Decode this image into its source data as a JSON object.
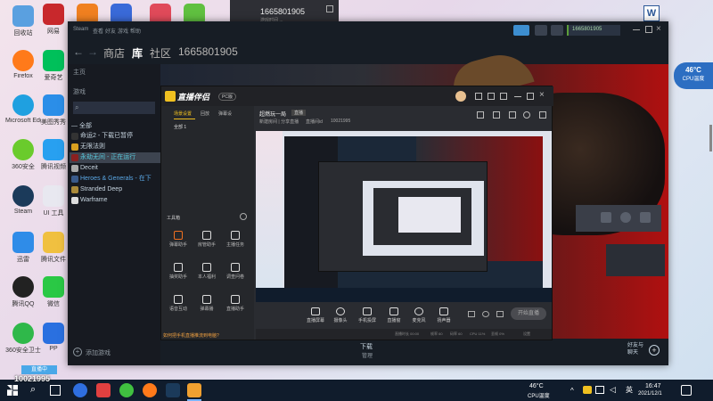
{
  "desktop": {
    "icons": [
      {
        "label": "回收站",
        "color": "#5aa0e0"
      },
      {
        "label": "网易",
        "color": "#c8282c"
      },
      {
        "label": "",
        "color": "#f08020"
      },
      {
        "label": "",
        "color": "#3a6ad8"
      },
      {
        "label": "",
        "color": "#e04a5a"
      },
      {
        "label": "",
        "color": "#60c040"
      },
      {
        "label": "Firefox",
        "color": "#ff7a1a"
      },
      {
        "label": "爱奇艺",
        "color": "#00c05a"
      },
      {
        "label": "Microsoft Edge",
        "color": "#1fa0e0"
      },
      {
        "label": "美图秀秀",
        "color": "#2b8ee8"
      },
      {
        "label": "360安全",
        "color": "#6acb2c"
      },
      {
        "label": "腾讯视频",
        "color": "#28a0f0"
      },
      {
        "label": "Steam",
        "color": "#1b3a5a"
      },
      {
        "label": "UI 工具",
        "color": "#e8e8f0"
      },
      {
        "label": "迅雷",
        "color": "#2f8ce8"
      },
      {
        "label": "腾讯文件",
        "color": "#f0c040"
      },
      {
        "label": "腾讯QQ",
        "color": "#222222"
      },
      {
        "label": "微信",
        "color": "#2ac845"
      },
      {
        "label": "360安全卫士",
        "color": "#2fb84a"
      },
      {
        "label": "PP",
        "color": "#2a70e0"
      }
    ],
    "top_right_icon": "W"
  },
  "overlay_window": {
    "title": "1665801905",
    "subtitle": "游戏时间 ..."
  },
  "steam": {
    "title": "Steam",
    "menu": [
      "Steam",
      "查看",
      "好友",
      "游戏",
      "帮助"
    ],
    "nav": [
      "商店",
      "库",
      "社区"
    ],
    "username": "1665801905",
    "account_badge": "1665801905",
    "lib_home": "主页",
    "games_label": "游戏",
    "all_label": "— 全部",
    "games": [
      {
        "name": "命运2 - 下载已暂停",
        "color": "#c6d4df",
        "icon": "#333"
      },
      {
        "name": "无限法则",
        "color": "#c6d4df",
        "icon": "#d8a020"
      },
      {
        "name": "永劫无间 - 正在运行",
        "color": "#57cbde",
        "icon": "#8a2020"
      },
      {
        "name": "Deceit",
        "color": "#c6d4df",
        "icon": "#aaa"
      },
      {
        "name": "Heroes & Generals - 在下",
        "color": "#5aa8e6",
        "icon": "#3a5a8a"
      },
      {
        "name": "Stranded Deep",
        "color": "#c6d4df",
        "icon": "#aa8a3a"
      },
      {
        "name": "Warframe",
        "color": "#c6d4df",
        "icon": "#ddd"
      }
    ],
    "add_game": "添加游戏",
    "download": "下载",
    "download_sub": "管理",
    "friends": "好友与\n聊天"
  },
  "cpu_badge": {
    "temp": "46°C",
    "label": "CPU温度"
  },
  "stream_app": {
    "logo": "直播伴侣",
    "version": "PC版",
    "tabs": [
      "场景设置",
      "回放",
      "弹幕设"
    ],
    "scene_item": "全部 1",
    "toolbox_label": "工具箱",
    "tools": [
      "弹幕助手",
      "房管助手",
      "主播任务",
      "抽奖助手",
      "本人福利",
      "调查问卷",
      "语音互动",
      "弹幕播",
      "直播助手",
      "",
      "",
      ""
    ],
    "footer_hint": "如何把手机直播推流到电脑?",
    "room_title": "超燃玩一局",
    "room_badge": "直播",
    "room_meta": "新建房间 | 分享直播",
    "room_id_label": "直播间id",
    "room_id": "10021995",
    "bottom_tools": [
      "直播屏幕",
      "摄像头",
      "手机投屏",
      "直播窗",
      "麦克风",
      "扬声器"
    ],
    "start_btn": "开始直播",
    "stats": [
      "直播时长 00:00",
      "帧率 60",
      "码率 60",
      "CPU 11%",
      "丢帧 0%",
      "设置"
    ]
  },
  "taskbar": {
    "temp": "46°C",
    "temp_label": "CPU温度",
    "lang": "英",
    "time": "16:47",
    "date": "2021/12/1",
    "overlay_id": "10021995",
    "overlay_label": "直播中"
  }
}
